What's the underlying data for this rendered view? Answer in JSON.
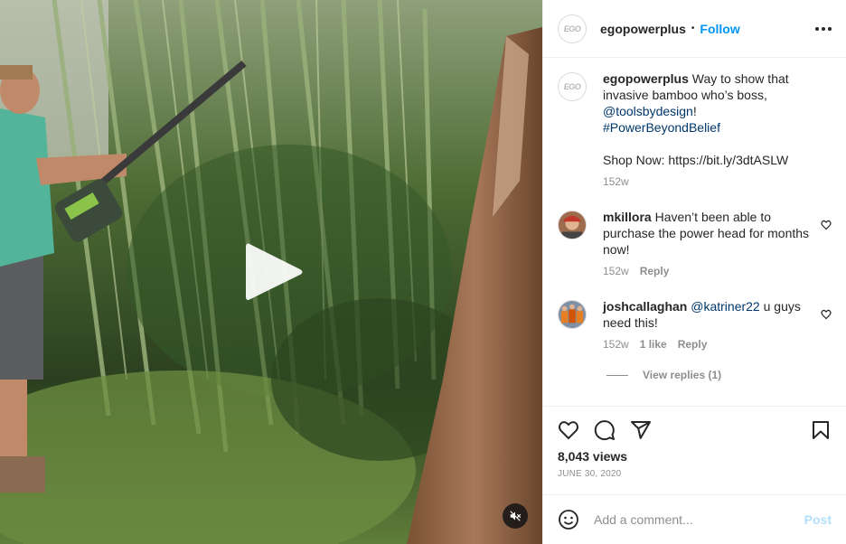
{
  "header": {
    "username": "egopowerplus",
    "separator": "•",
    "follow_label": "Follow",
    "avatar_logo": "EGO"
  },
  "caption": {
    "username": "egopowerplus",
    "text_1": " Way to show that invasive bamboo who’s boss, ",
    "mention": "@toolsbydesign",
    "text_2": "!",
    "hashtag": "#PowerBeyondBelief",
    "shop": "Shop Now: https://bit.ly/3dtASLW",
    "time": "152w"
  },
  "comments": [
    {
      "username": "mkillora",
      "text": " Haven’t been able to purchase the power head for months now!",
      "time": "152w",
      "reply_label": "Reply"
    },
    {
      "username": "joshcallaghan",
      "mention": "@katriner22",
      "text": " u guys need this!",
      "time": "152w",
      "likes": "1 like",
      "reply_label": "Reply",
      "view_replies": "View replies (1)"
    }
  ],
  "stats": {
    "views": "8,043 views",
    "date": "JUNE 30, 2020"
  },
  "composer": {
    "placeholder": "Add a comment...",
    "post_label": "Post"
  },
  "icons": [
    "heart-icon",
    "comment-icon",
    "share-icon",
    "bookmark-icon",
    "emoji-icon",
    "more-options-icon",
    "play-icon",
    "muted-speaker-icon"
  ],
  "colors": {
    "accent": "#0095f6",
    "link": "#00376b",
    "muted": "#8e8e8e",
    "post_disabled": "#b2dffc"
  }
}
